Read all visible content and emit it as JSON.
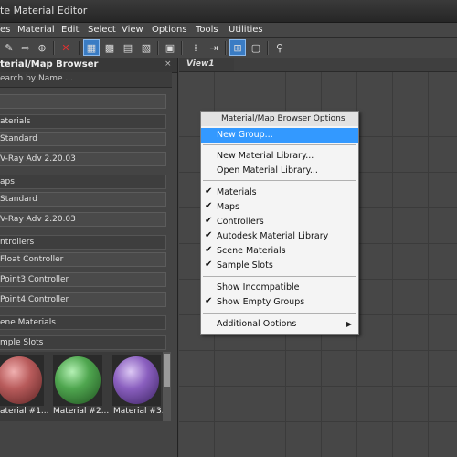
{
  "window": {
    "title": "te Material Editor"
  },
  "menubar": [
    "es",
    "Material",
    "Edit",
    "Select",
    "View",
    "Options",
    "Tools",
    "Utilities"
  ],
  "browser": {
    "title": "terial/Map Browser",
    "close": "×",
    "search_placeholder": "earch by Name ...",
    "rows": [
      {
        "text": "",
        "group": false
      },
      {
        "text": "aterials",
        "group": true
      },
      {
        "text": "Standard",
        "group": false
      },
      {
        "text": "V-Ray Adv 2.20.03",
        "group": false
      },
      {
        "text": "aps",
        "group": true
      },
      {
        "text": "Standard",
        "group": false
      },
      {
        "text": "V-Ray Adv 2.20.03",
        "group": false
      },
      {
        "text": "ntrollers",
        "group": true
      },
      {
        "text": "Float Controller",
        "group": false
      },
      {
        "text": "Point3 Controller",
        "group": false
      },
      {
        "text": "Point4 Controller",
        "group": false
      },
      {
        "text": "ene Materials",
        "group": true
      },
      {
        "text": "mple Slots",
        "group": true
      }
    ],
    "slots": [
      {
        "label": "aterial #1...",
        "color": "#b85b5b"
      },
      {
        "label": "Material #2...",
        "color": "#4fa64f"
      },
      {
        "label": "Material #3.",
        "color": "#8a5fbf"
      }
    ]
  },
  "view": {
    "tab": "View1"
  },
  "context_menu": {
    "header": "Material/Map Browser Options",
    "items": [
      {
        "label": "New Group...",
        "checked": false,
        "highlight": true
      },
      {
        "label": "New Material Library...",
        "checked": false
      },
      {
        "label": "Open Material Library...",
        "checked": false
      },
      {
        "label": "Materials",
        "checked": true
      },
      {
        "label": "Maps",
        "checked": true
      },
      {
        "label": "Controllers",
        "checked": true
      },
      {
        "label": "Autodesk Material Library",
        "checked": true
      },
      {
        "label": "Scene Materials",
        "checked": true
      },
      {
        "label": "Sample Slots",
        "checked": true
      },
      {
        "label": "Show Incompatible",
        "checked": false
      },
      {
        "label": "Show Empty Groups",
        "checked": true
      },
      {
        "label": "Additional Options",
        "checked": false,
        "submenu": true
      }
    ],
    "check_glyph": "✔",
    "submenu_glyph": "▶"
  },
  "colors": {
    "highlight": "#3399ff",
    "toolbar_active": "#3a7cc4"
  }
}
